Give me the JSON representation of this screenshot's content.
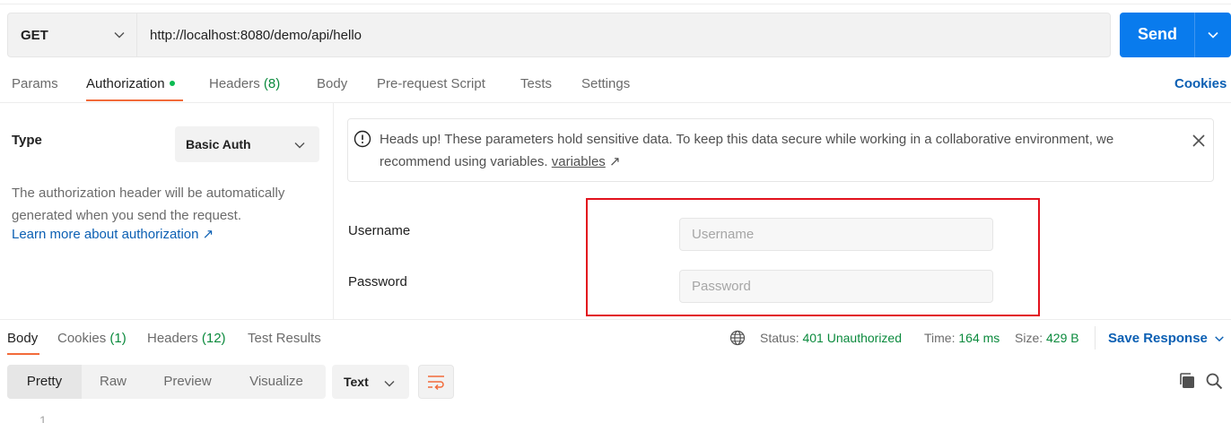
{
  "request": {
    "method": "GET",
    "url": "http://localhost:8080/demo/api/hello",
    "send_label": "Send"
  },
  "request_tabs": {
    "params": "Params",
    "authorization": "Authorization",
    "headers": "Headers",
    "headers_count": "(8)",
    "body": "Body",
    "pre_request_script": "Pre-request Script",
    "tests": "Tests",
    "settings": "Settings",
    "active": "Authorization",
    "cookies_link": "Cookies"
  },
  "auth": {
    "type_label": "Type",
    "type_value": "Basic Auth",
    "description": "The authorization header will be automatically generated when you send the request.",
    "learn_more": "Learn more about authorization ↗"
  },
  "warning": {
    "text": "Heads up! These parameters hold sensitive data. To keep this data secure while working in a collaborative environment, we recommend using variables. ",
    "link": "variables",
    "link_arrow": " ↗"
  },
  "credentials": {
    "username_label": "Username",
    "username_placeholder": "Username",
    "password_label": "Password",
    "password_placeholder": "Password"
  },
  "response_tabs": {
    "body": "Body",
    "cookies": "Cookies",
    "cookies_count": "(1)",
    "headers": "Headers",
    "headers_count": "(12)",
    "test_results": "Test Results",
    "active": "Body"
  },
  "response_meta": {
    "status_label": "Status:",
    "status_value": "401 Unauthorized",
    "time_label": "Time:",
    "time_value": "164 ms",
    "size_label": "Size:",
    "size_value": "429 B",
    "save_response": "Save Response"
  },
  "view": {
    "modes": [
      "Pretty",
      "Raw",
      "Preview",
      "Visualize"
    ],
    "active_mode": "Pretty",
    "format": "Text",
    "first_line_number": "1"
  },
  "colors": {
    "accent_blue": "#097bed",
    "tab_underline": "#f26b3a",
    "success_green": "#0b8a3d",
    "highlight_red": "#e2121d"
  },
  "icons": [
    "chevron-down-icon",
    "alert-circle-icon",
    "close-icon",
    "globe-icon",
    "wrap-lines-icon",
    "copy-icon",
    "search-icon"
  ]
}
